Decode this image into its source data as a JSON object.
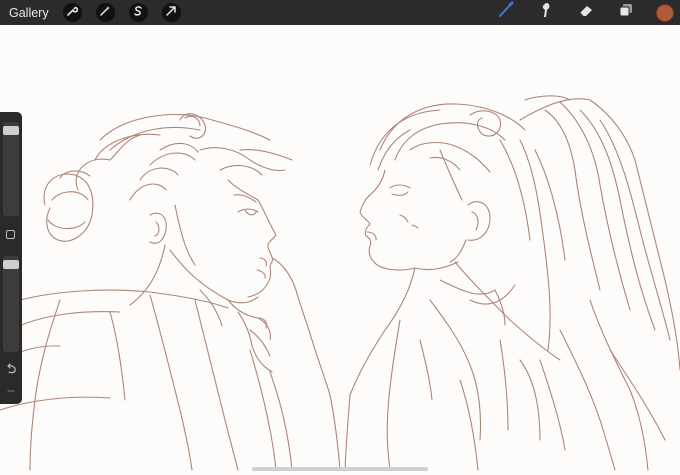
{
  "topbar": {
    "gallery_label": "Gallery",
    "left_tools": [
      "wrench-icon",
      "magic-wand-icon",
      "selection-icon",
      "transform-arrow-icon"
    ],
    "right_tools": [
      "brush-icon",
      "smudge-icon",
      "eraser-icon",
      "layers-icon"
    ],
    "active_tool": "brush-icon",
    "active_tool_color": "#3a7bd5",
    "current_color": "#b4583c"
  },
  "sidebar": {
    "brush_size_level": 0.05,
    "opacity_level": 0.05
  },
  "canvas": {
    "sketch_color": "#a5796a",
    "subject": "pencil-sketch-two-figures"
  }
}
